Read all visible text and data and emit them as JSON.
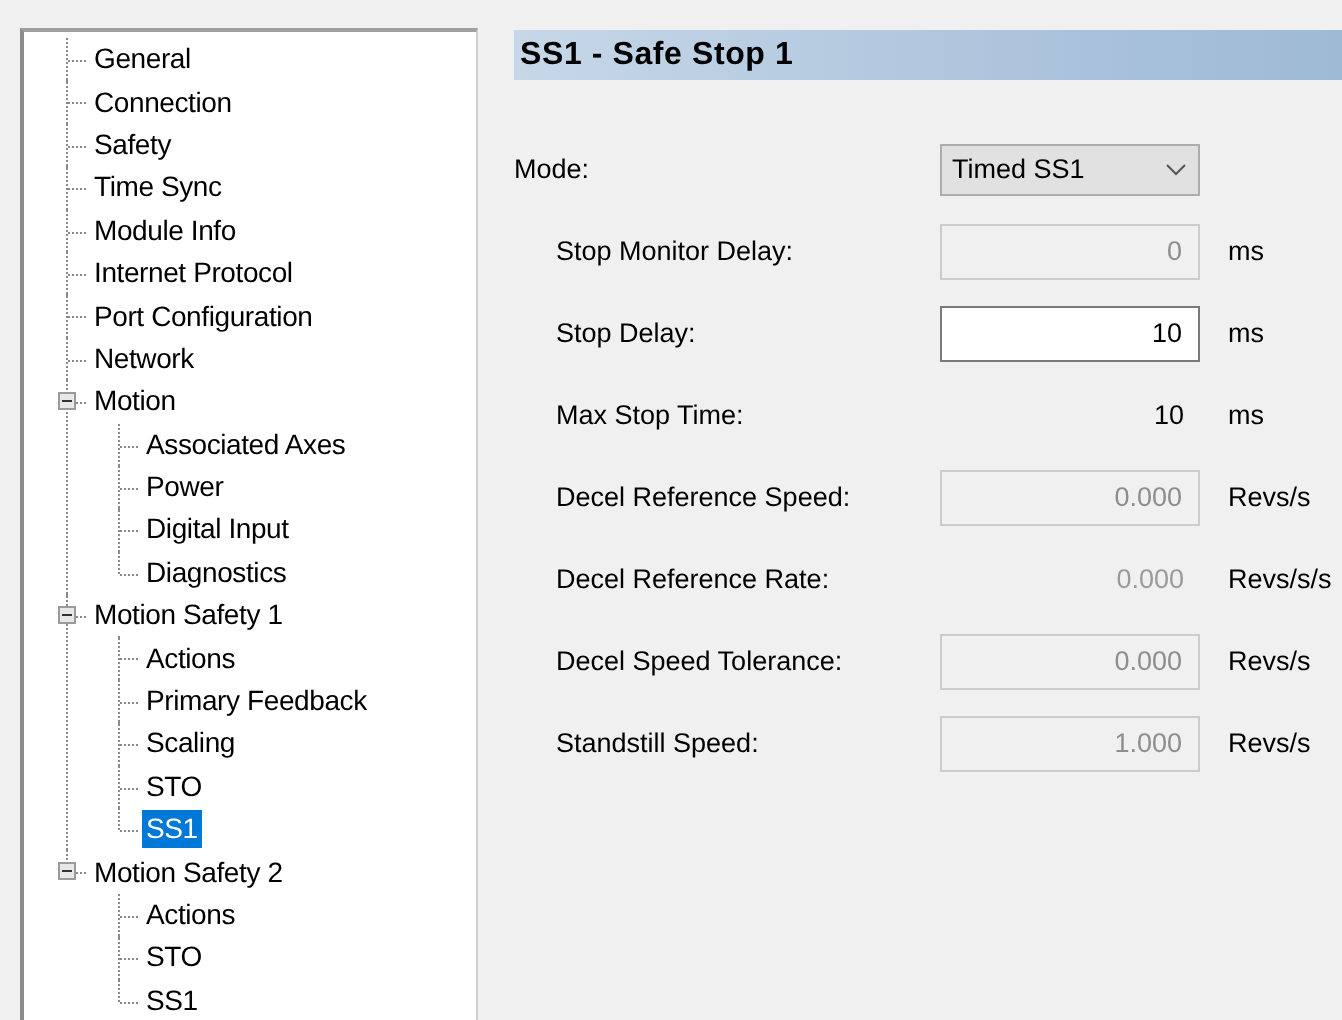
{
  "tree": {
    "items": [
      {
        "label": "General",
        "selected": false
      },
      {
        "label": "Connection",
        "selected": false
      },
      {
        "label": "Safety",
        "selected": false
      },
      {
        "label": "Time Sync",
        "selected": false
      },
      {
        "label": "Module Info",
        "selected": false
      },
      {
        "label": "Internet Protocol",
        "selected": false
      },
      {
        "label": "Port Configuration",
        "selected": false
      },
      {
        "label": "Network",
        "selected": false
      },
      {
        "label": "Motion",
        "selected": false,
        "expanded": true,
        "children": [
          {
            "label": "Associated Axes",
            "selected": false
          },
          {
            "label": "Power",
            "selected": false
          },
          {
            "label": "Digital Input",
            "selected": false
          },
          {
            "label": "Diagnostics",
            "selected": false
          }
        ]
      },
      {
        "label": "Motion Safety 1",
        "selected": false,
        "expanded": true,
        "children": [
          {
            "label": "Actions",
            "selected": false
          },
          {
            "label": "Primary Feedback",
            "selected": false
          },
          {
            "label": "Scaling",
            "selected": false
          },
          {
            "label": "STO",
            "selected": false
          },
          {
            "label": "SS1",
            "selected": true
          }
        ]
      },
      {
        "label": "Motion Safety 2",
        "selected": false,
        "expanded": true,
        "children": [
          {
            "label": "Actions",
            "selected": false
          },
          {
            "label": "STO",
            "selected": false
          },
          {
            "label": "SS1",
            "selected": false
          }
        ]
      }
    ]
  },
  "header": {
    "title": "SS1 - Safe Stop 1"
  },
  "form": {
    "rows": [
      {
        "kind": "dropdown",
        "label": "Mode:",
        "value": "Timed SS1"
      },
      {
        "kind": "field",
        "label": "Stop Monitor Delay:",
        "value": "0",
        "unit": "ms",
        "disabled": true
      },
      {
        "kind": "field",
        "label": "Stop Delay:",
        "value": "10",
        "unit": "ms",
        "disabled": false
      },
      {
        "kind": "readout",
        "label": "Max Stop Time:",
        "value": "10",
        "unit": "ms",
        "disabled": false
      },
      {
        "kind": "field",
        "label": "Decel Reference Speed:",
        "value": "0.000",
        "unit": "Revs/s",
        "disabled": true
      },
      {
        "kind": "readout",
        "label": "Decel Reference Rate:",
        "value": "0.000",
        "unit": "Revs/s/s",
        "disabled": true
      },
      {
        "kind": "field",
        "label": "Decel Speed Tolerance:",
        "value": "0.000",
        "unit": "Revs/s",
        "disabled": true
      },
      {
        "kind": "field",
        "label": "Standstill Speed:",
        "value": "1.000",
        "unit": "Revs/s",
        "disabled": true
      }
    ]
  }
}
